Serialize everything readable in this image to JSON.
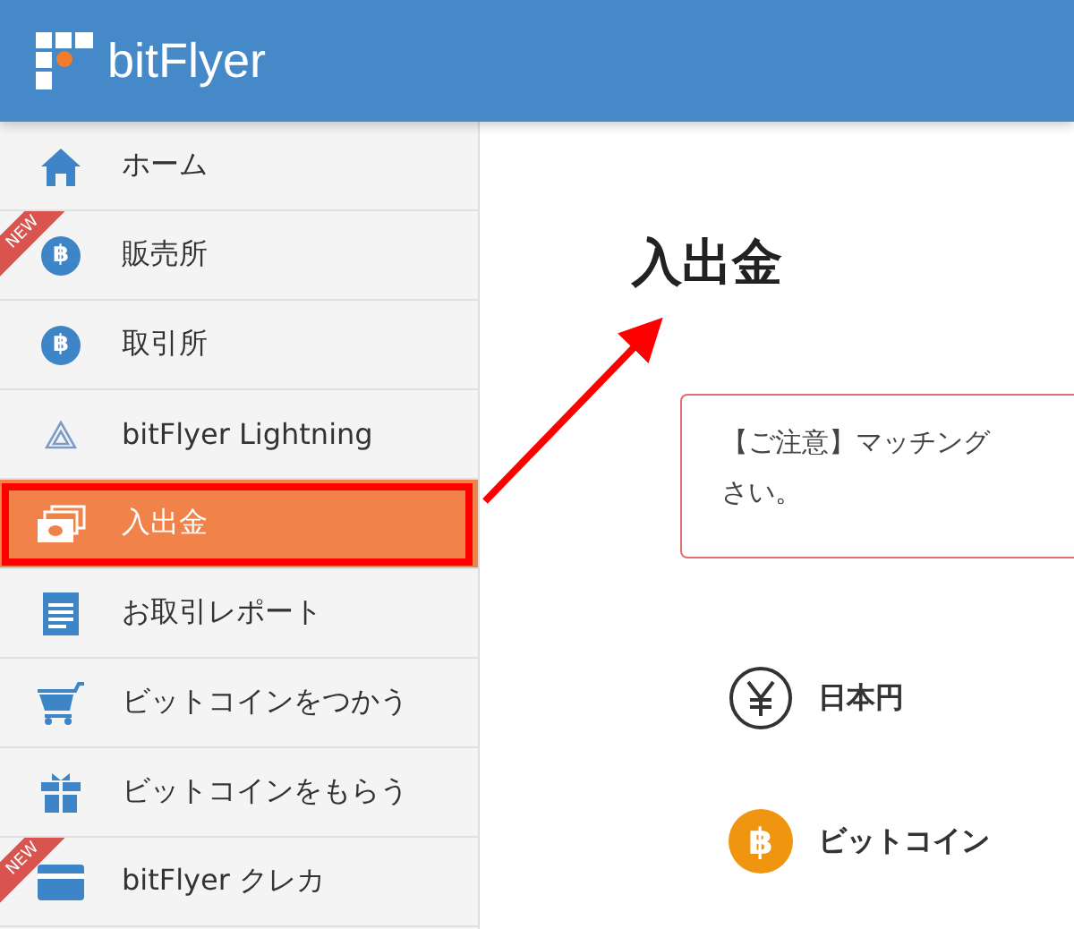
{
  "header": {
    "logo_text": "bitFlyer"
  },
  "sidebar": {
    "items": [
      {
        "label": "ホーム",
        "kind": "home",
        "selected": false,
        "annotated": false
      },
      {
        "label": "販売所",
        "kind": "coin",
        "symbol": "฿",
        "new_badge": "NEW",
        "selected": false,
        "annotated": false
      },
      {
        "label": "取引所",
        "kind": "coin",
        "symbol": "฿",
        "selected": false,
        "annotated": false
      },
      {
        "label": "bitFlyer Lightning",
        "kind": "lightning",
        "selected": false,
        "annotated": false
      },
      {
        "label": "入出金",
        "kind": "money",
        "selected": true,
        "annotated": true
      },
      {
        "label": "お取引レポート",
        "kind": "report",
        "selected": false,
        "annotated": false
      },
      {
        "label": "ビットコインをつかう",
        "kind": "cart",
        "selected": false,
        "annotated": false
      },
      {
        "label": "ビットコインをもらう",
        "kind": "gift",
        "selected": false,
        "annotated": false
      },
      {
        "label": "bitFlyer クレカ",
        "kind": "card",
        "new_badge": "NEW",
        "selected": false,
        "annotated": false
      }
    ]
  },
  "main": {
    "title": "入出金",
    "notice": {
      "lines": [
        "【ご注意】マッチング",
        "さい。"
      ]
    },
    "currencies": [
      {
        "label": "日本円",
        "kind": "yen"
      },
      {
        "label": "ビットコイン",
        "kind": "btc",
        "symbol": "฿"
      }
    ]
  }
}
